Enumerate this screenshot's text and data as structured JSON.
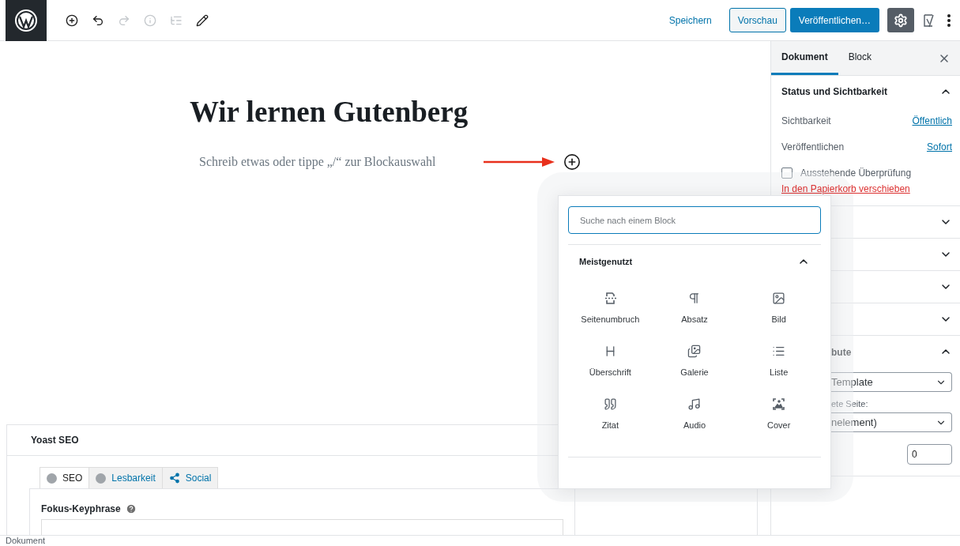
{
  "toolbar": {
    "tools": [
      {
        "kind": "add",
        "disabled": false
      },
      {
        "kind": "undo",
        "disabled": false
      },
      {
        "kind": "redo",
        "disabled": true
      },
      {
        "kind": "info",
        "disabled": true
      },
      {
        "kind": "outline",
        "disabled": true
      },
      {
        "kind": "edit",
        "disabled": false
      }
    ],
    "save": "Speichern",
    "preview": "Vorschau",
    "publish": "Veröffentlichen…",
    "settings_active": true
  },
  "editor": {
    "title": "Wir lernen Gutenberg",
    "placeholder": "Schreib etwas oder tippe „/“ zur Blockauswahl"
  },
  "inserter": {
    "search_placeholder": "Suche nach einem Block",
    "section": "Meistgenutzt",
    "expanded": true,
    "blocks": [
      {
        "kind": "pagebreak",
        "label": "Seitenumbruch"
      },
      {
        "kind": "paragraph",
        "label": "Absatz"
      },
      {
        "kind": "image",
        "label": "Bild"
      },
      {
        "kind": "heading",
        "label": "Überschrift"
      },
      {
        "kind": "gallery",
        "label": "Galerie"
      },
      {
        "kind": "list",
        "label": "Liste"
      },
      {
        "kind": "quote",
        "label": "Zitat"
      },
      {
        "kind": "audio",
        "label": "Audio"
      },
      {
        "kind": "cover",
        "label": "Cover"
      }
    ]
  },
  "sidebar": {
    "tabs": [
      {
        "label": "Dokument",
        "selected": true
      },
      {
        "label": "Block",
        "selected": false
      }
    ],
    "status_panel": {
      "title": "Status und Sichtbarkeit",
      "expanded": true,
      "rows": [
        {
          "label": "Sichtbarkeit",
          "value": "Öffentlich"
        },
        {
          "label": "Veröffentlichen",
          "value": "Sofort"
        }
      ],
      "checkbox": {
        "label": "Ausstehende Überprüfung",
        "checked": false
      },
      "trash_link": "In den Papierkorb verschieben"
    },
    "collapsed_panels": [
      {
        "expanded": false
      },
      {
        "expanded": false
      },
      {
        "expanded": false
      },
      {
        "expanded": false
      }
    ],
    "attributes_panel": {
      "title": "bute",
      "expanded": true,
      "template_select": "Template",
      "parent_label": "ete Seite:",
      "parent_select": "nelement)",
      "order_value": "0"
    }
  },
  "yoast": {
    "title": "Yoast SEO",
    "tabs": [
      {
        "kind": "score",
        "label": "SEO",
        "selected": true,
        "color": "#a0a5aa"
      },
      {
        "kind": "score",
        "label": "Lesbarkeit",
        "selected": false,
        "color": "#a0a5aa"
      },
      {
        "kind": "social",
        "label": "Social",
        "selected": false
      }
    ],
    "field_label": "Fokus-Keyphrase"
  },
  "status_bar": "Dokument"
}
